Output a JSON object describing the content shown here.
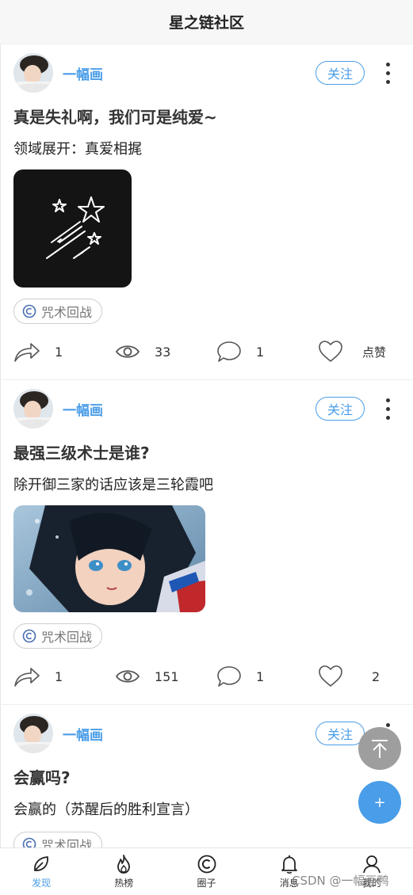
{
  "header": {
    "title": "星之链社区"
  },
  "posts": [
    {
      "author": "一幅画",
      "follow_label": "关注",
      "title": "真是失礼啊，我们可是纯爱~",
      "body": "领域展开：真爱相捤",
      "tag": "咒术回战",
      "shares": "1",
      "views": "33",
      "comments": "1",
      "likes": "点赞"
    },
    {
      "author": "一幅画",
      "follow_label": "关注",
      "title": "最强三级术士是谁?",
      "body": "除开御三家的话应该是三轮霞吧",
      "tag": "咒术回战",
      "shares": "1",
      "views": "151",
      "comments": "1",
      "likes": "2"
    },
    {
      "author": "一幅画",
      "follow_label": "关注",
      "title": "会赢吗?",
      "body": "会赢的（苏醒后的胜利宣言）",
      "tag": "咒术回战"
    }
  ],
  "fab": {
    "add_label": "+"
  },
  "tabbar": {
    "items": [
      {
        "label": "发现",
        "icon": "leaf-icon",
        "active": true
      },
      {
        "label": "热榜",
        "icon": "flame-icon"
      },
      {
        "label": "圈子",
        "icon": "circle-c-icon"
      },
      {
        "label": "消息",
        "icon": "bell-icon"
      },
      {
        "label": "我的",
        "icon": "user-icon"
      }
    ]
  },
  "watermark": "CSDN @一幅画鸭",
  "colors": {
    "accent": "#4a9de8",
    "fab_gray": "#9e9e9e"
  }
}
